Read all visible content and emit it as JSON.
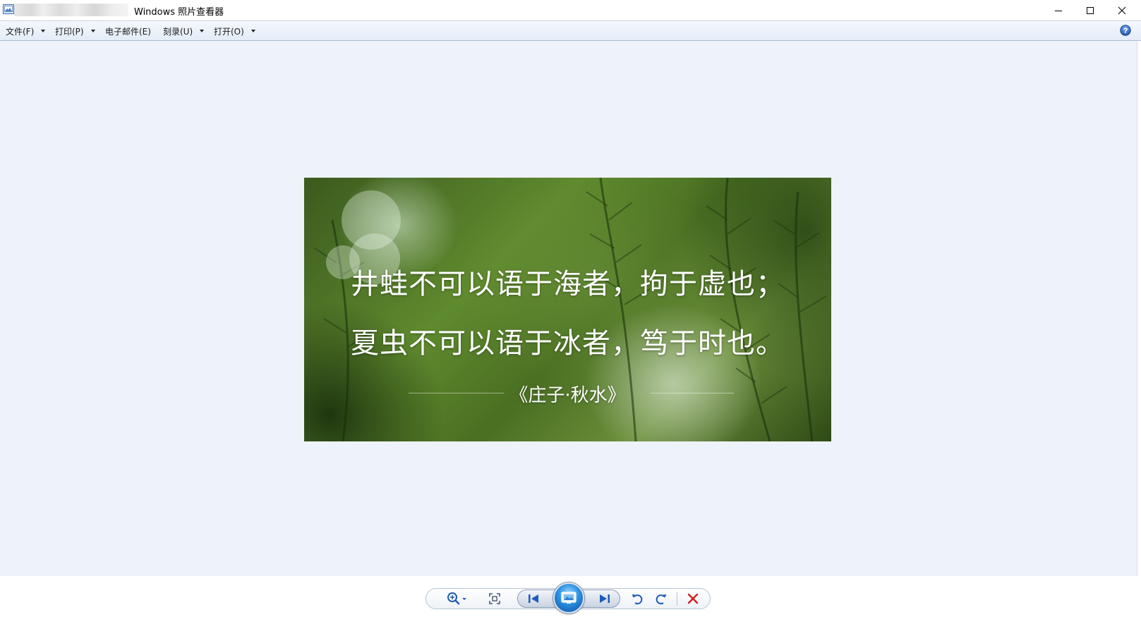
{
  "window": {
    "title": "Windows 照片查看器",
    "icons": {
      "app": "photo-viewer-app-icon",
      "minimize": "minimize-icon",
      "maximize": "maximize-icon",
      "close": "close-icon"
    }
  },
  "menu": {
    "items": [
      {
        "label": "文件(F)",
        "has_dropdown": true
      },
      {
        "label": "打印(P)",
        "has_dropdown": true
      },
      {
        "label": "电子邮件(E)",
        "has_dropdown": false
      },
      {
        "label": "刻录(U)",
        "has_dropdown": true
      },
      {
        "label": "打开(O)",
        "has_dropdown": true
      }
    ],
    "help_icon": "help-icon"
  },
  "photo": {
    "quote_line_1": "井蛙不可以语于海者，拘于虚也；",
    "quote_line_2": "夏虫不可以语于冰者，笃于时也。",
    "source": "《庄子·秋水》"
  },
  "toolbar": {
    "controls": [
      {
        "name": "zoom",
        "icon": "magnifier-zoom-icon",
        "has_dropdown": true
      },
      {
        "name": "actual-size",
        "icon": "fit-window-icon"
      },
      {
        "name": "previous",
        "icon": "previous-icon"
      },
      {
        "name": "slideshow",
        "icon": "slideshow-icon"
      },
      {
        "name": "next",
        "icon": "next-icon"
      },
      {
        "name": "rotate-counterclockwise",
        "icon": "rotate-left-icon"
      },
      {
        "name": "rotate-clockwise",
        "icon": "rotate-right-icon"
      },
      {
        "name": "delete",
        "icon": "delete-icon"
      }
    ]
  },
  "colors": {
    "viewer_background": "#eef2fa",
    "menubar_top": "#f4f8fd",
    "menubar_bottom": "#e3ecf8",
    "delete_red": "#d11f1f",
    "control_blue": "#1e5bb8"
  }
}
